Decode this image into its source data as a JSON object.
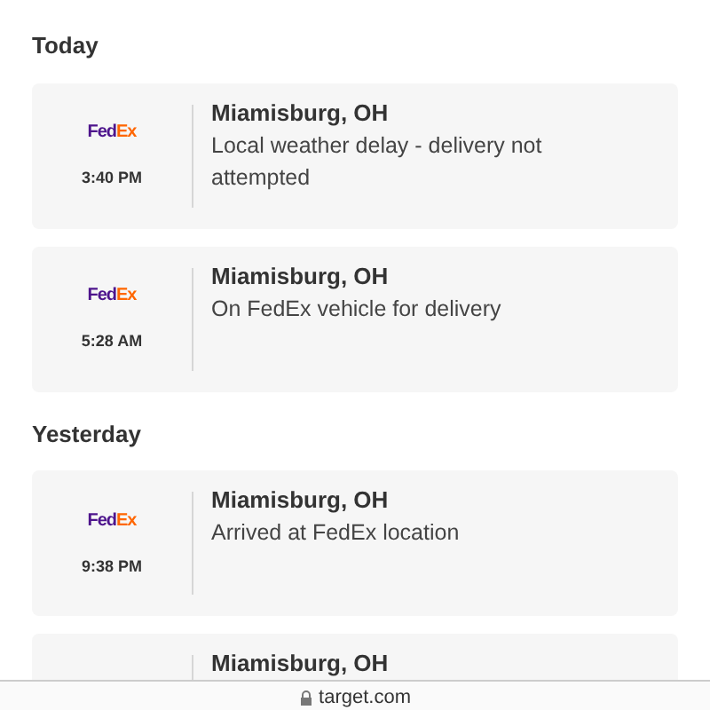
{
  "sections": [
    {
      "heading": "Today",
      "events": [
        {
          "logo": [
            {
              "text": "Fed",
              "color": "#4d148c"
            },
            {
              "text": "Ex",
              "color": "#ff6600"
            }
          ],
          "time": "3:40 PM",
          "location": "Miamisburg, OH",
          "status": "Local weather delay - delivery not attempted"
        },
        {
          "logo": [
            {
              "text": "Fed",
              "color": "#4d148c"
            },
            {
              "text": "Ex",
              "color": "#ff6600"
            }
          ],
          "time": "5:28 AM",
          "location": "Miamisburg, OH",
          "status": "On FedEx vehicle for delivery"
        }
      ]
    },
    {
      "heading": "Yesterday",
      "events": [
        {
          "logo": [
            {
              "text": "Fed",
              "color": "#4d148c"
            },
            {
              "text": "Ex",
              "color": "#ff6600"
            }
          ],
          "time": "9:38 PM",
          "location": "Miamisburg, OH",
          "status": "Arrived at FedEx location"
        },
        {
          "location": "Miamisburg, OH"
        }
      ]
    }
  ],
  "address_bar": {
    "url": "target.com"
  }
}
